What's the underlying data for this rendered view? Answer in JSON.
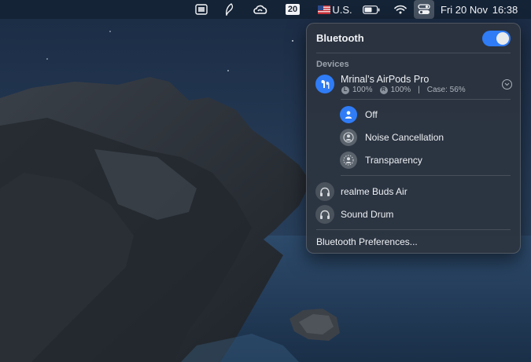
{
  "menubar": {
    "calendar_badge": "20",
    "input_source": "U.S.",
    "clock_date": "Fri 20 Nov",
    "clock_time": "16:38",
    "icons": [
      "screen-mirroring-icon",
      "pen-icon",
      "creative-cloud-icon",
      "calendar-badge",
      "us-flag-icon",
      "battery-icon",
      "wifi-icon",
      "control-center-icon"
    ]
  },
  "bluetooth": {
    "title": "Bluetooth",
    "enabled": true,
    "section_label": "Devices",
    "connected_device": {
      "name": "Mrinal’s AirPods Pro",
      "left_badge": "L",
      "left_battery": "100%",
      "right_badge": "R",
      "right_battery": "100%",
      "separator": "|",
      "case_battery": "Case: 56%",
      "icon": "airpods-icon",
      "expand_icon": "chevron-down-icon"
    },
    "modes": [
      {
        "label": "Off",
        "selected": true,
        "icon": "person-icon"
      },
      {
        "label": "Noise Cancellation",
        "selected": false,
        "icon": "noise-cancellation-icon"
      },
      {
        "label": "Transparency",
        "selected": false,
        "icon": "transparency-icon"
      }
    ],
    "other_devices": [
      {
        "name": "realme Buds Air",
        "icon": "headphones-icon"
      },
      {
        "name": "Sound Drum",
        "icon": "headphones-icon"
      }
    ],
    "preferences_label": "Bluetooth Preferences..."
  },
  "colors": {
    "accent": "#2f7cf6",
    "panel": "#2c3440",
    "menubar": "#142030"
  }
}
